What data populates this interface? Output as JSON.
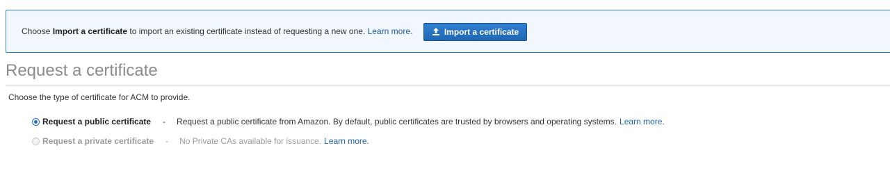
{
  "info_box": {
    "text_before": "Choose ",
    "text_bold": "Import a certificate",
    "text_after": " to import an existing certificate instead of requesting a new one.",
    "learn_more": "Learn more.",
    "import_button_label": "Import a certificate",
    "import_button_icon": "upload-icon"
  },
  "page": {
    "title": "Request a certificate",
    "description": "Choose the type of certificate for ACM to provide."
  },
  "options": [
    {
      "label": "Request a public certificate",
      "dash": "-",
      "detail": "Request a public certificate from Amazon. By default, public certificates are trusted by browsers and operating systems.",
      "learn_more": "Learn more.",
      "selected": true,
      "disabled": false
    },
    {
      "label": "Request a private certificate",
      "dash": "-",
      "detail": "No Private CAs available for issuance.",
      "learn_more": "Learn more.",
      "selected": false,
      "disabled": true
    }
  ],
  "colors": {
    "accent": "#1f6fd1",
    "info_border": "#2f7dc3",
    "info_background": "#f1f7fc",
    "link": "#1a5fa8"
  }
}
